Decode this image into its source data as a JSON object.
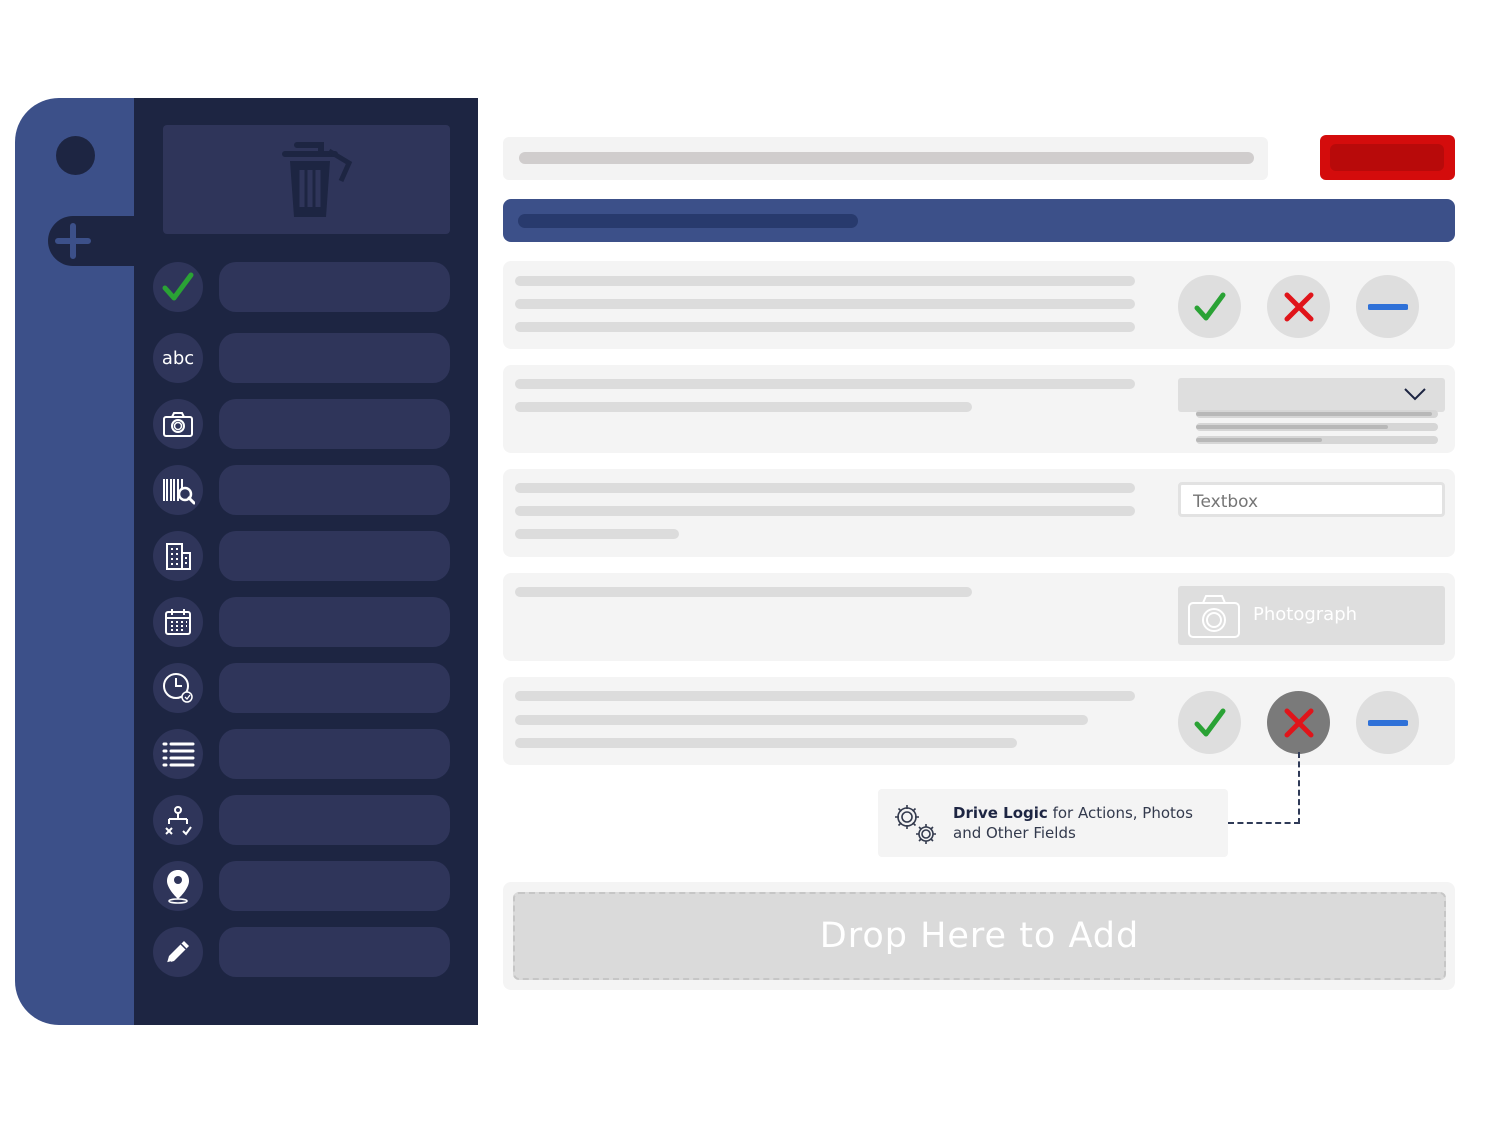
{
  "colors": {
    "rail": "#3c5089",
    "toolbox": "#1d2542",
    "toolbox_pill": "#2f355a",
    "accent_red": "#d40c0c",
    "check_green": "#2aa235",
    "cross_red": "#e0141a",
    "minus_blue": "#2f71d8"
  },
  "toolbox": {
    "trash_icon": "trash-icon",
    "tools": [
      {
        "icon": "checkmark-icon"
      },
      {
        "icon": "text-abc-icon",
        "label": "abc"
      },
      {
        "icon": "camera-icon"
      },
      {
        "icon": "barcode-scan-icon"
      },
      {
        "icon": "building-icon"
      },
      {
        "icon": "calendar-icon"
      },
      {
        "icon": "clock-icon"
      },
      {
        "icon": "list-icon"
      },
      {
        "icon": "logic-flow-icon"
      },
      {
        "icon": "location-pin-icon"
      },
      {
        "icon": "pencil-icon"
      }
    ]
  },
  "form": {
    "textbox_placeholder": "Textbox",
    "photo_label": "Photograph",
    "dropdown_icon": "chevron-down-icon",
    "answers": [
      "yes",
      "no",
      "n/a"
    ],
    "second_question_selected": "no"
  },
  "tooltip": {
    "bold": "Drive Logic",
    "rest": " for Actions, Photos and Other Fields",
    "icon": "gears-icon"
  },
  "dropzone": {
    "label": "Drop Here to Add"
  }
}
